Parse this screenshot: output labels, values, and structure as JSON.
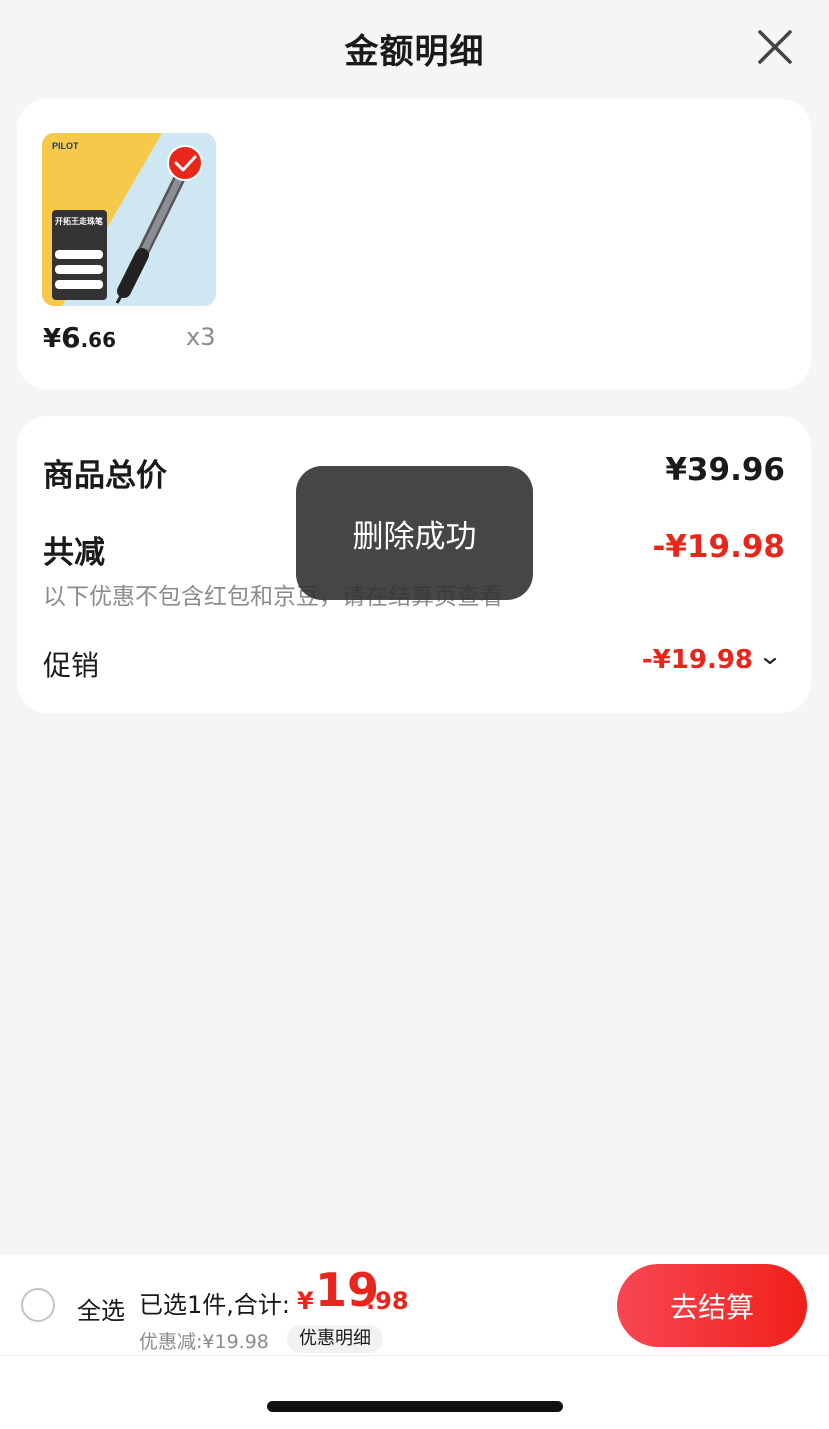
{
  "header": {
    "title": "金额明细"
  },
  "product": {
    "image_brand": "PILOT",
    "image_title": "开拓王走珠笔",
    "price_currency": "¥",
    "price_int": "6",
    "price_dec": ".66",
    "quantity": "x3"
  },
  "summary": {
    "total_label": "商品总价",
    "total_value": "¥39.96",
    "reduce_label": "共减",
    "reduce_value": "-¥19.98",
    "note": "以下优惠不包含红包和京豆，请在结算页查看",
    "promo_label": "促销",
    "promo_value": "-¥19.98"
  },
  "toast": {
    "text": "删除成功"
  },
  "bottom": {
    "select_all": "全选",
    "selected_text": "已选1件,合计:",
    "total_currency": "¥",
    "total_int": "19",
    "total_dec": ".98",
    "discount_text": "优惠减:¥19.98",
    "detail_button": "优惠明细",
    "checkout_button": "去结算"
  },
  "colors": {
    "accent": "#e8261c",
    "toast_bg": "#323232"
  }
}
